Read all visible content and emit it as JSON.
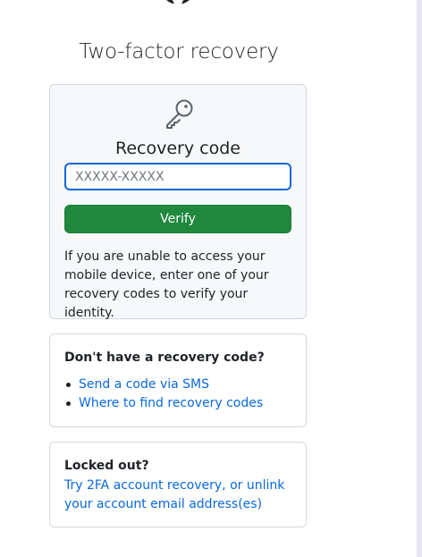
{
  "page": {
    "title": "Two-factor recovery"
  },
  "icons": {
    "logo": "github-logo-icon",
    "key": "key-icon"
  },
  "recovery_form": {
    "label": "Recovery code",
    "input_placeholder": "XXXXX-XXXXX",
    "input_value": "",
    "verify_label": "Verify",
    "help_text": "If you are unable to access your mobile device, enter one of your recovery codes to verify your identity."
  },
  "alternatives": {
    "heading": "Don't have a recovery code?",
    "links": [
      {
        "label": "Send a code via SMS"
      },
      {
        "label": "Where to find recovery codes"
      }
    ]
  },
  "locked_out": {
    "heading": "Locked out?",
    "link_label": "Try 2FA account recovery, or unlink your account email address(es)"
  },
  "colors": {
    "primary_button": "#1f883d",
    "link": "#0969da",
    "focus_border": "#0969da",
    "panel_bg": "#f6f8fa",
    "border": "#d1d9e0"
  }
}
